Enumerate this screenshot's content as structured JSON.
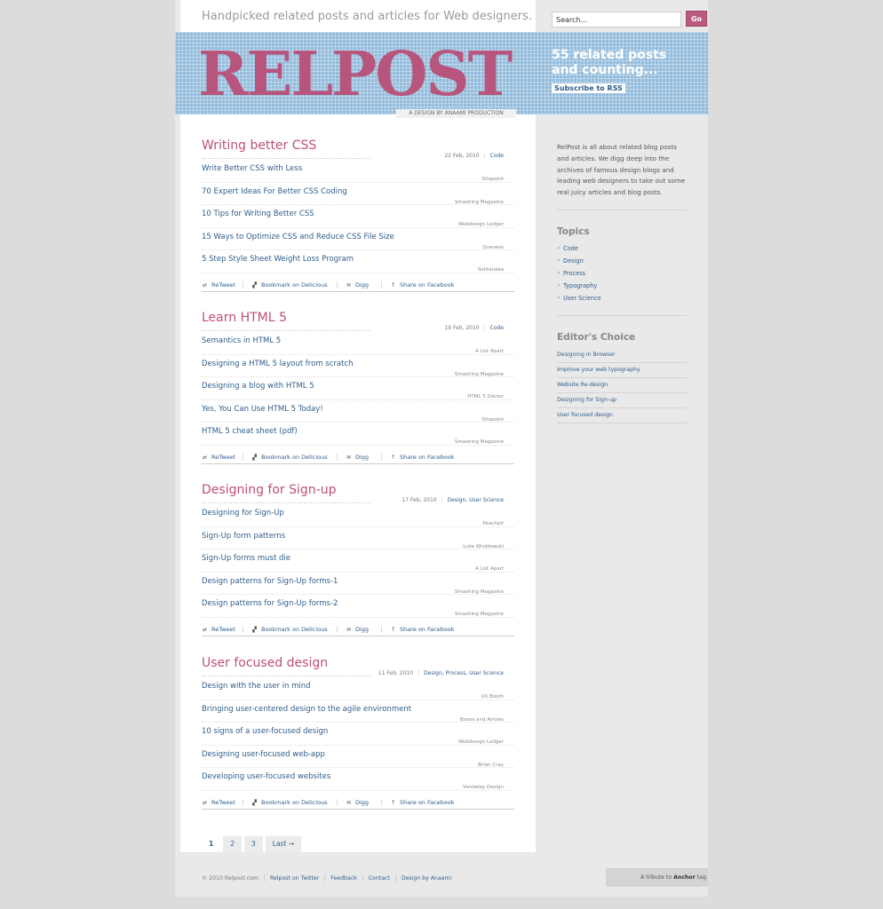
{
  "header": {
    "tagline": "Handpicked related posts and articles for Web designers.",
    "search": {
      "placeholder": "Search...",
      "value": "Search...",
      "button_label": "Go"
    }
  },
  "banner": {
    "logo": "RELPOST",
    "counter": "55 related posts and counting...",
    "rss_label": "Subscribe to RSS",
    "credit": "A DESIGN BY ANAAMI PRODUCTION",
    "colors": {
      "banner": "#93bcdc",
      "logo": "#b8557c",
      "accent": "#bf4f79"
    }
  },
  "share_labels": {
    "retweet": "ReTweet",
    "delicious": "Bookmark on Delicious",
    "digg": "Digg",
    "facebook": "Share on Facebook"
  },
  "articles": [
    {
      "title": "Writing better CSS",
      "date": "22 Feb, 2010",
      "categories": "Code",
      "links": [
        {
          "title": "Write Better CSS with Less",
          "source": "Sitepoint"
        },
        {
          "title": "70 Expert Ideas For Better CSS Coding",
          "source": "Smashing Magazine"
        },
        {
          "title": "10 Tips for Writing Better CSS",
          "source": "Webdesign Ledger"
        },
        {
          "title": "15 Ways to Optimize CSS and Reduce CSS File Size",
          "source": "Queness"
        },
        {
          "title": "5 Step Style Sheet Weight Loss Program",
          "source": "Sohtanaka"
        }
      ]
    },
    {
      "title": "Learn HTML 5",
      "date": "19 Feb, 2010",
      "categories": "Code",
      "links": [
        {
          "title": "Semantics in HTML 5",
          "source": "A List Apart"
        },
        {
          "title": "Designing a HTML 5 layout from scratch",
          "source": "Smashing Magazine"
        },
        {
          "title": "Designing a blog with HTML 5",
          "source": "HTML 5 Doctor"
        },
        {
          "title": "Yes, You Can Use HTML 5 Today!",
          "source": "Sitepoint"
        },
        {
          "title": "HTML 5 cheat sheet (pdf)",
          "source": "Smashing Magazine"
        }
      ]
    },
    {
      "title": "Designing for Sign-up",
      "date": "17 Feb, 2010",
      "categories": "Design, User Science",
      "links": [
        {
          "title": "Designing for Sign-Up",
          "source": "Peachpit"
        },
        {
          "title": "Sign-Up form patterns",
          "source": "Luke Wroblewski"
        },
        {
          "title": "Sign-Up forms must die",
          "source": "A List Apart"
        },
        {
          "title": "Design patterns for Sign-Up forms-1",
          "source": "Smashing Magazine"
        },
        {
          "title": "Design patterns for Sign-Up forms-2",
          "source": "Smashing Magazine"
        }
      ]
    },
    {
      "title": "User focused design",
      "date": "11 Feb, 2010",
      "categories": "Design, Process, User Science",
      "links": [
        {
          "title": "Design with the user in mind",
          "source": "UX Booth"
        },
        {
          "title": "Bringing user-centered design to the agile environment",
          "source": "Boxes and Arrows"
        },
        {
          "title": "10 signs of a user-focused design",
          "source": "Webdesign Ledger"
        },
        {
          "title": "Designing user-focused web-app",
          "source": "Brian Cray"
        },
        {
          "title": "Developing user-focused websites",
          "source": "Vandelay Design"
        }
      ]
    }
  ],
  "pagination": [
    "1",
    "2",
    "3",
    "Last →"
  ],
  "sidebar": {
    "about": "RelPost is all about related blog posts and articles. We digg deep into the archives of famous design blogs and leading web designers to take out some real juicy articles and blog posts.",
    "topics_heading": "Topics",
    "topics": [
      "Code",
      "Design",
      "Process",
      "Typography",
      "User Science"
    ],
    "editors_heading": "Editor's Choice",
    "editors_choice": [
      "Designing in Browser",
      "Improve your web typography",
      "Website Re-design",
      "Designing for Sign-up",
      "User focused design"
    ]
  },
  "footer": {
    "copyright": "© 2010 Relpost.com",
    "links": [
      "Relpost on Twitter",
      "Feedback",
      "Contact",
      "Design by Anaami"
    ],
    "tribute_prefix": "A tribute to",
    "tribute_name": "Anchor",
    "tribute_suffix": "tag."
  }
}
